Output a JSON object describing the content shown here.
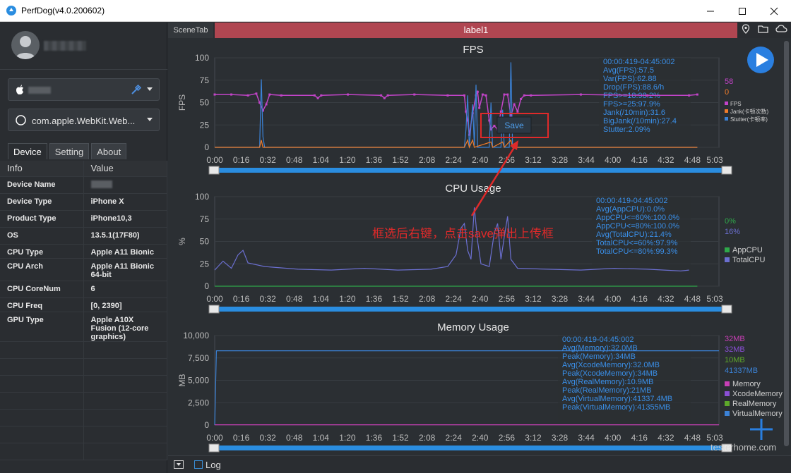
{
  "window": {
    "title": "PerfDog(v4.0.200602)"
  },
  "device_selector": {
    "label": ""
  },
  "app_selector": {
    "label": "com.apple.WebKit.Web..."
  },
  "tabs": [
    {
      "label": "Device"
    },
    {
      "label": "Setting"
    },
    {
      "label": "About"
    }
  ],
  "info_table": {
    "headers": [
      "Info",
      "Value"
    ],
    "rows": [
      {
        "k": "Device Name",
        "v": ""
      },
      {
        "k": "Device Type",
        "v": "iPhone X"
      },
      {
        "k": "Product Type",
        "v": "iPhone10,3"
      },
      {
        "k": "OS",
        "v": "13.5.1(17F80)"
      },
      {
        "k": "CPU Type",
        "v": "Apple A11 Bionic"
      },
      {
        "k": "CPU Arch",
        "v": "Apple A11 Bionic 64-bit"
      },
      {
        "k": "CPU CoreNum",
        "v": "6"
      },
      {
        "k": "CPU Freq",
        "v": "[0, 2390]"
      },
      {
        "k": "GPU Type",
        "v": "Apple A10X Fusion (12-core graphics)"
      }
    ]
  },
  "scene_bar": {
    "scene_tab": "SceneTab",
    "label": "label1"
  },
  "bottom_bar": {
    "log_label": "Log"
  },
  "annotation": {
    "text": "框选后右键，点击save弹出上传框",
    "save_button": "Save"
  },
  "watermark": "testerhome.com",
  "time_ticks": [
    "0:00",
    "0:16",
    "0:32",
    "0:48",
    "1:04",
    "1:20",
    "1:36",
    "1:52",
    "2:08",
    "2:24",
    "2:40",
    "2:56",
    "3:12",
    "3:28",
    "3:44",
    "4:00",
    "4:16",
    "4:32",
    "4:48",
    "5:03"
  ],
  "colors": {
    "fps": "#c244c8",
    "jank": "#f07c2a",
    "stutter": "#3b82d6",
    "appcpu": "#2fa84a",
    "totalcpu": "#6b6fd0",
    "memory": "#c83fb5",
    "xcode": "#8a4fd6",
    "real": "#5da82a",
    "virtual": "#3b82d6",
    "accent": "#2a8de0"
  },
  "chart_data": [
    {
      "type": "line",
      "title": "FPS",
      "ylabel": "FPS",
      "ylim": [
        0,
        100
      ],
      "yticks": [
        0,
        25,
        50,
        75,
        100
      ],
      "stats": [
        "00:00:419-04:45:002",
        "Avg(FPS):57.5",
        "Var(FPS):62.88",
        "Drop(FPS):88.6/h",
        "FPS>=18:98.2%",
        "FPS>=25:97.9%",
        "Jank(/10min):31.6",
        "BigJank(/10min):27.4",
        "Stutter:2.09%"
      ],
      "current_values": [
        {
          "text": "58",
          "color": "#c244c8"
        },
        {
          "text": "0",
          "color": "#f07c2a"
        }
      ],
      "legend": [
        {
          "name": "FPS",
          "color": "#c244c8"
        },
        {
          "name": "Jank(卡顿次数)",
          "color": "#f07c2a"
        },
        {
          "name": "Stutter(卡顿率)",
          "color": "#3b82d6"
        }
      ],
      "series": [
        {
          "name": "FPS",
          "points": [
            [
              0,
              59
            ],
            [
              10,
              59
            ],
            [
              20,
              58
            ],
            [
              25,
              60
            ],
            [
              27,
              50
            ],
            [
              29,
              41
            ],
            [
              31,
              48
            ],
            [
              33,
              59
            ],
            [
              40,
              58
            ],
            [
              60,
              58
            ],
            [
              62,
              55
            ],
            [
              64,
              58
            ],
            [
              80,
              59
            ],
            [
              100,
              58
            ],
            [
              102,
              55
            ],
            [
              104,
              58
            ],
            [
              120,
              59
            ],
            [
              140,
              58
            ],
            [
              150,
              58
            ],
            [
              151,
              40
            ],
            [
              152,
              30
            ],
            [
              153,
              14
            ],
            [
              155,
              38
            ],
            [
              157,
              58
            ],
            [
              158,
              62
            ],
            [
              159,
              44
            ],
            [
              161,
              59
            ],
            [
              163,
              58
            ],
            [
              165,
              30
            ],
            [
              166,
              20
            ],
            [
              168,
              24
            ],
            [
              170,
              20
            ],
            [
              172,
              40
            ],
            [
              174,
              59
            ],
            [
              176,
              59
            ],
            [
              178,
              35
            ],
            [
              180,
              48
            ],
            [
              182,
              40
            ],
            [
              184,
              54
            ],
            [
              186,
              58
            ],
            [
              190,
              58
            ],
            [
              220,
              59
            ],
            [
              260,
              58
            ],
            [
              290,
              59
            ],
            [
              285,
              58
            ]
          ]
        },
        {
          "name": "Stutter",
          "points": [
            [
              0,
              0
            ],
            [
              27,
              0
            ],
            [
              28,
              76
            ],
            [
              29,
              12
            ],
            [
              30,
              0
            ],
            [
              150,
              0
            ],
            [
              151,
              20
            ],
            [
              152,
              58
            ],
            [
              153,
              0
            ],
            [
              155,
              48
            ],
            [
              156,
              2
            ],
            [
              157,
              70
            ],
            [
              158,
              0
            ],
            [
              165,
              0
            ],
            [
              166,
              50
            ],
            [
              167,
              0
            ],
            [
              172,
              0
            ],
            [
              173,
              42
            ],
            [
              174,
              0
            ],
            [
              177,
              0
            ],
            [
              178,
              95
            ],
            [
              179,
              0
            ],
            [
              290,
              0
            ]
          ]
        },
        {
          "name": "Jank",
          "points": [
            [
              0,
              0
            ],
            [
              27,
              0
            ],
            [
              28,
              8
            ],
            [
              29,
              0
            ],
            [
              150,
              0
            ],
            [
              152,
              8
            ],
            [
              153,
              0
            ],
            [
              155,
              8
            ],
            [
              156,
              0
            ],
            [
              166,
              6
            ],
            [
              167,
              0
            ],
            [
              173,
              6
            ],
            [
              174,
              0
            ],
            [
              178,
              8
            ],
            [
              179,
              0
            ],
            [
              290,
              0
            ]
          ]
        }
      ]
    },
    {
      "type": "line",
      "title": "CPU Usage",
      "ylabel": "%",
      "ylim": [
        0,
        100
      ],
      "yticks": [
        0,
        25,
        50,
        75,
        100
      ],
      "stats": [
        "00:00:419-04:45:002",
        "Avg(AppCPU):0.0%",
        "AppCPU<=60%:100.0%",
        "AppCPU<=80%:100.0%",
        "Avg(TotalCPU):21.4%",
        "TotalCPU<=60%:97.9%",
        "TotalCPU<=80%:99.3%"
      ],
      "current_values": [
        {
          "text": "0%",
          "color": "#2fa84a"
        },
        {
          "text": "16%",
          "color": "#6b6fd0"
        }
      ],
      "legend": [
        {
          "name": "AppCPU",
          "color": "#2fa84a"
        },
        {
          "name": "TotalCPU",
          "color": "#6b6fd0"
        }
      ],
      "series": [
        {
          "name": "TotalCPU",
          "points": [
            [
              0,
              18
            ],
            [
              5,
              28
            ],
            [
              10,
              20
            ],
            [
              14,
              35
            ],
            [
              17,
              40
            ],
            [
              20,
              26
            ],
            [
              30,
              22
            ],
            [
              50,
              19
            ],
            [
              70,
              18
            ],
            [
              90,
              20
            ],
            [
              110,
              18
            ],
            [
              130,
              19
            ],
            [
              140,
              22
            ],
            [
              145,
              35
            ],
            [
              148,
              65
            ],
            [
              150,
              70
            ],
            [
              152,
              40
            ],
            [
              154,
              30
            ],
            [
              156,
              88
            ],
            [
              158,
              50
            ],
            [
              160,
              25
            ],
            [
              165,
              22
            ],
            [
              168,
              60
            ],
            [
              170,
              70
            ],
            [
              172,
              30
            ],
            [
              174,
              55
            ],
            [
              176,
              78
            ],
            [
              178,
              30
            ],
            [
              182,
              20
            ],
            [
              200,
              19
            ],
            [
              220,
              18
            ],
            [
              240,
              20
            ],
            [
              260,
              19
            ],
            [
              280,
              17
            ],
            [
              285,
              18
            ]
          ]
        },
        {
          "name": "AppCPU",
          "points": [
            [
              0,
              0
            ],
            [
              290,
              0
            ]
          ]
        }
      ]
    },
    {
      "type": "line",
      "title": "Memory Usage",
      "ylabel": "MB",
      "ylim": [
        0,
        10000
      ],
      "yticks": [
        "0",
        "2,500",
        "5,000",
        "7,500",
        "10,000"
      ],
      "stats": [
        "00:00:419-04:45:002",
        "Avg(Memory):32.0MB",
        "Peak(Memory):34MB",
        "Avg(XcodeMemory):32.0MB",
        "Peak(XcodeMemory):34MB",
        "Avg(RealMemory):10.9MB",
        "Peak(RealMemory):21MB",
        "Avg(VirtualMemory):41337.4MB",
        "Peak(VirtualMemory):41355MB"
      ],
      "current_values": [
        {
          "text": "32MB",
          "color": "#c83fb5"
        },
        {
          "text": "32MB",
          "color": "#8a4fd6"
        },
        {
          "text": "10MB",
          "color": "#5da82a"
        },
        {
          "text": "41337MB",
          "color": "#3b82d6"
        }
      ],
      "legend": [
        {
          "name": "Memory",
          "color": "#c83fb5"
        },
        {
          "name": "XcodeMemory",
          "color": "#8a4fd6"
        },
        {
          "name": "RealMemory",
          "color": "#5da82a"
        },
        {
          "name": "VirtualMemory",
          "color": "#3b82d6"
        }
      ],
      "series": [
        {
          "name": "VirtualMemory",
          "points": [
            [
              0,
              0
            ],
            [
              1,
              8300
            ],
            [
              303,
              8300
            ]
          ]
        },
        {
          "name": "Memory",
          "points": [
            [
              0,
              32
            ],
            [
              303,
              32
            ]
          ]
        }
      ]
    }
  ]
}
